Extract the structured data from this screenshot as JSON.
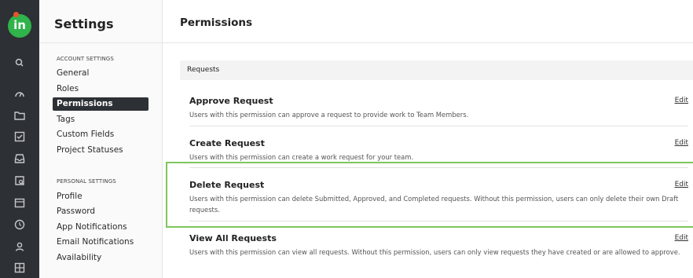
{
  "app": {
    "logo_text": "in",
    "brand_color": "#2fb34a",
    "accent_dot_color": "#e8532c"
  },
  "rail": {
    "icons": [
      "search-icon",
      "dashboard-icon",
      "folder-icon",
      "tasks-icon",
      "inbox-icon",
      "reports-icon",
      "calendar-icon",
      "time-icon",
      "people-icon",
      "board-icon"
    ]
  },
  "sidebar": {
    "title": "Settings",
    "account_section_title": "ACCOUNT SETTINGS",
    "account_items": [
      "General",
      "Roles",
      "Permissions",
      "Tags",
      "Custom Fields",
      "Project Statuses"
    ],
    "active_item": "Permissions",
    "personal_section_title": "PERSONAL SETTINGS",
    "personal_items": [
      "Profile",
      "Password",
      "App Notifications",
      "Email Notifications",
      "Availability"
    ]
  },
  "main": {
    "title": "Permissions",
    "group_title": "Requests",
    "edit_label": "Edit",
    "permissions": [
      {
        "title": "Approve Request",
        "description": "Users with this permission can approve a request to provide work to Team Members."
      },
      {
        "title": "Create Request",
        "description": "Users with this permission can create a work request for your team."
      },
      {
        "title": "Delete Request",
        "description": "Users with this permission can delete Submitted, Approved, and Completed requests. Without this permission, users can only delete their own Draft requests."
      },
      {
        "title": "View All Requests",
        "description": "Users with this permission can view all requests. Without this permission, users can only view requests they have created or are allowed to approve."
      }
    ],
    "highlight_color": "#7cc65c"
  }
}
